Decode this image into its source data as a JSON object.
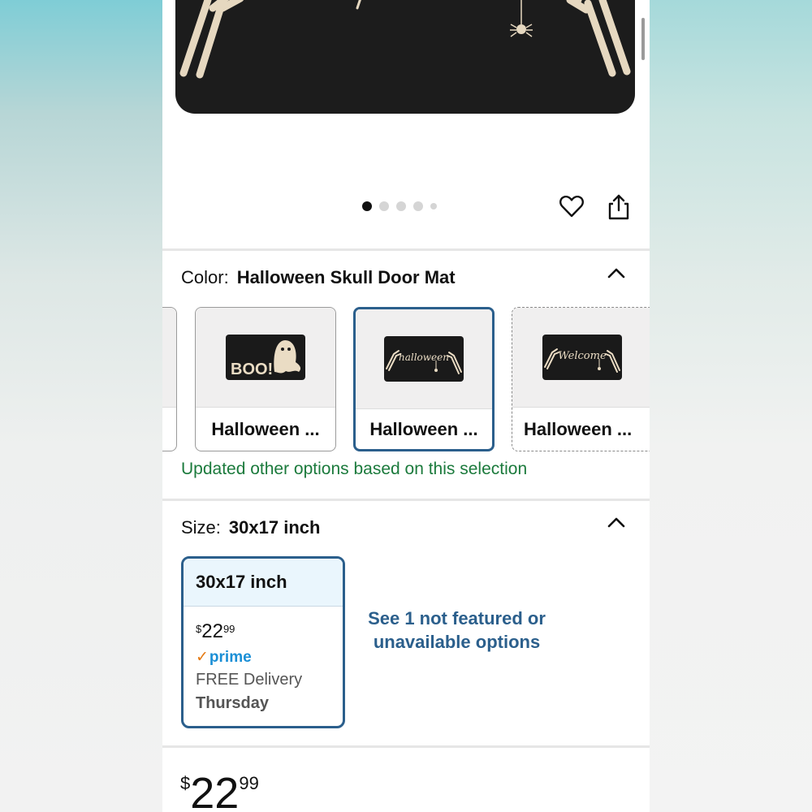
{
  "gallery": {
    "image_count": 5,
    "active_index": 0
  },
  "color": {
    "label": "Color:",
    "value": "Halloween Skull Door Mat",
    "options": [
      {
        "label": "Halloween ...",
        "image": "boo-ghost-mat",
        "mat_text": "BOO!"
      },
      {
        "label": "Halloween ...",
        "image": "skeleton-halloween-mat",
        "mat_text": "halloween",
        "selected": true
      },
      {
        "label": "Halloween ...",
        "image": "skeleton-welcome-mat",
        "mat_text": "Welcome",
        "dashed": true
      }
    ],
    "updated_notice": "Updated other options based on this selection"
  },
  "size": {
    "label": "Size:",
    "value": "30x17 inch",
    "card": {
      "title": "30x17 inch",
      "price_currency": "$",
      "price_whole": "22",
      "price_fraction": "99",
      "prime_label": "prime",
      "delivery": "FREE Delivery",
      "delivery_day": "Thursday"
    },
    "see_more": "See 1 not featured or unavailable options"
  },
  "price": {
    "currency": "$",
    "whole": "22",
    "fraction": "99"
  },
  "colors": {
    "accent_blue": "#2b5f8c",
    "success_green": "#1b7a3c",
    "prime_blue": "#1a8fd6",
    "prime_check": "#e47911"
  },
  "icons": [
    "heart-icon",
    "share-icon",
    "chevron-up-icon",
    "chevron-up-icon"
  ]
}
